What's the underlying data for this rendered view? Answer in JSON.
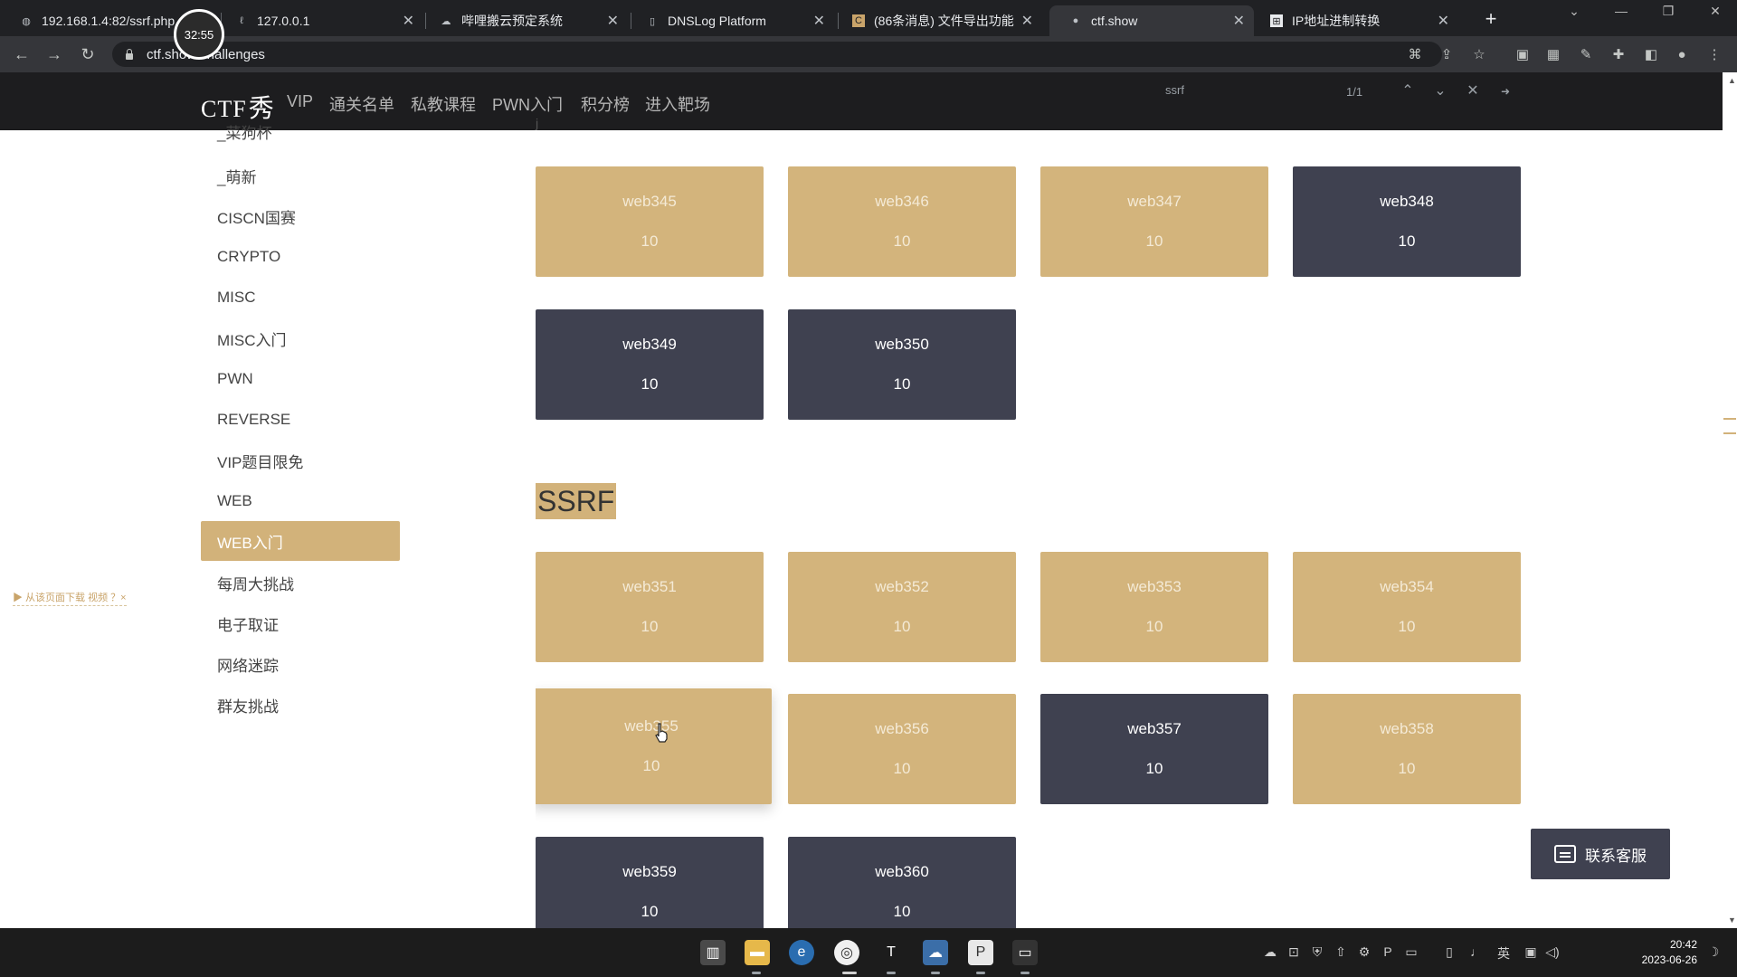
{
  "browser": {
    "tabs": [
      {
        "title": "192.168.1.4:82/ssrf.php",
        "icon": "globe-icon",
        "active": false
      },
      {
        "title": "127.0.0.1",
        "icon": "ie-icon",
        "active": false
      },
      {
        "title": "哔哩搬云预定系统",
        "icon": "cloud-icon",
        "active": false
      },
      {
        "title": "DNSLog Platform",
        "icon": "file-icon",
        "active": false
      },
      {
        "title": "(86条消息) 文件导出功能",
        "icon": "csdn-icon",
        "active": false
      },
      {
        "title": "ctf.show",
        "icon": "ctf-icon",
        "active": true
      },
      {
        "title": "IP地址进制转换",
        "icon": "tool-icon",
        "active": false
      }
    ],
    "new_tab": "+",
    "address": "ctf.show/challenges",
    "recording_timer": "32:55"
  },
  "site": {
    "brand": "CTF",
    "brand_mark": "秀",
    "nav": [
      "VIP",
      "通关名单",
      "私教课程",
      "PWN入门",
      "积分榜",
      "进入靶场"
    ]
  },
  "find": {
    "query": "ssrf",
    "count": "1/1"
  },
  "sidebar": {
    "items": [
      {
        "label": "_菜狗杯"
      },
      {
        "label": "_萌新"
      },
      {
        "label": "CISCN国赛"
      },
      {
        "label": "CRYPTO"
      },
      {
        "label": "MISC"
      },
      {
        "label": "MISC入门"
      },
      {
        "label": "PWN"
      },
      {
        "label": "REVERSE"
      },
      {
        "label": "VIP题目限免"
      },
      {
        "label": "WEB"
      },
      {
        "label": "WEB入门",
        "active": true
      },
      {
        "label": "每周大挑战"
      },
      {
        "label": "电子取证"
      },
      {
        "label": "网络迷踪"
      },
      {
        "label": "群友挑战"
      }
    ],
    "download_hint": "▶ 从该页面下载 视频 ？×"
  },
  "content": {
    "prev_group": [
      {
        "name": "web345",
        "points": "10",
        "solved": true
      },
      {
        "name": "web346",
        "points": "10",
        "solved": true
      },
      {
        "name": "web347",
        "points": "10",
        "solved": true
      },
      {
        "name": "web348",
        "points": "10",
        "solved": false
      },
      {
        "name": "web349",
        "points": "10",
        "solved": false
      },
      {
        "name": "web350",
        "points": "10",
        "solved": false
      }
    ],
    "section_title": "SSRF",
    "ssrf_group": [
      {
        "name": "web351",
        "points": "10",
        "solved": true
      },
      {
        "name": "web352",
        "points": "10",
        "solved": true
      },
      {
        "name": "web353",
        "points": "10",
        "solved": true
      },
      {
        "name": "web354",
        "points": "10",
        "solved": true
      },
      {
        "name": "web355",
        "points": "10",
        "solved": true,
        "hovered": true
      },
      {
        "name": "web356",
        "points": "10",
        "solved": true
      },
      {
        "name": "web357",
        "points": "10",
        "solved": false
      },
      {
        "name": "web358",
        "points": "10",
        "solved": true
      },
      {
        "name": "web359",
        "points": "10",
        "solved": false
      },
      {
        "name": "web360",
        "points": "10",
        "solved": false
      }
    ]
  },
  "contact": {
    "label": "联系客服"
  },
  "taskbar": {
    "time": "20:42",
    "date": "2023-06-26",
    "ime": "英"
  },
  "colors": {
    "solved": "#d3b47c",
    "unsolved": "#3f4150",
    "accent": "#d2b27a",
    "navbar": "#1d1d1f"
  }
}
